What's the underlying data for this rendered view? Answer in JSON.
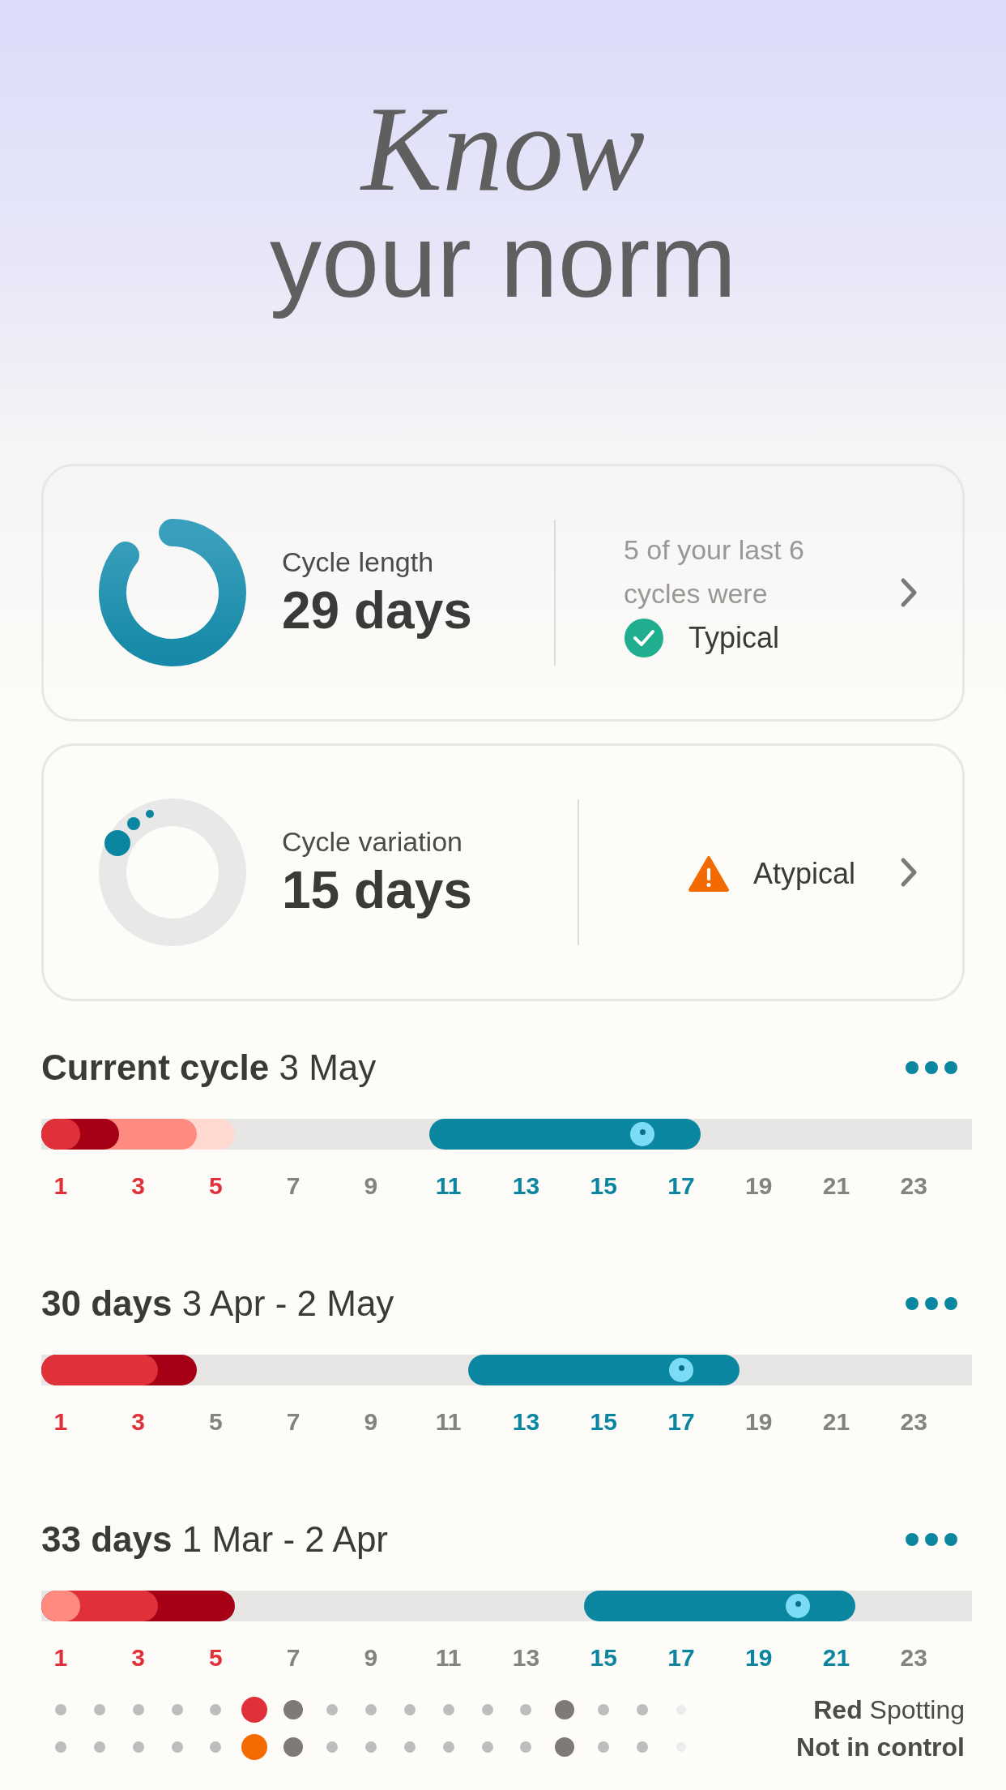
{
  "hero": {
    "line_1": "Know",
    "line_2": "your norm"
  },
  "cards": [
    {
      "kind": "length",
      "label": "Cycle length",
      "value": "29 days",
      "note": "5 of your last 6 cycles were",
      "status": {
        "kind": "typical",
        "label": "Typical"
      }
    },
    {
      "kind": "variation",
      "label": "Cycle variation",
      "value": "15 days",
      "status": {
        "kind": "atypical",
        "label": "Atypical"
      }
    }
  ],
  "cycles": [
    {
      "title_bold": "Current cycle",
      "title_rest": "3 May",
      "days": [
        {
          "kind": "medium"
        },
        {
          "kind": "heavy"
        },
        {
          "kind": "light"
        },
        {
          "kind": "light"
        },
        {
          "kind": "spotting"
        },
        {
          "kind": "none"
        },
        {
          "kind": "none"
        },
        {
          "kind": "none"
        },
        {
          "kind": "none"
        },
        {
          "kind": "none"
        },
        {
          "kind": "fertile"
        },
        {
          "kind": "fertile"
        },
        {
          "kind": "fertile"
        },
        {
          "kind": "fertile"
        },
        {
          "kind": "fertile"
        },
        {
          "kind": "ovulation"
        },
        {
          "kind": "fertile"
        },
        {
          "kind": "none"
        },
        {
          "kind": "none"
        },
        {
          "kind": "none"
        },
        {
          "kind": "none"
        },
        {
          "kind": "none"
        },
        {
          "kind": "none"
        },
        {
          "kind": "none"
        }
      ],
      "labels": [
        "1",
        "3",
        "5",
        "7",
        "9",
        "11",
        "13",
        "15",
        "17",
        "19",
        "21",
        "23"
      ]
    },
    {
      "title_bold": "30 days",
      "title_rest": "3 Apr - 2 May",
      "days": [
        {
          "kind": "medium"
        },
        {
          "kind": "medium"
        },
        {
          "kind": "medium"
        },
        {
          "kind": "heavy"
        },
        {
          "kind": "none"
        },
        {
          "kind": "none"
        },
        {
          "kind": "none"
        },
        {
          "kind": "none"
        },
        {
          "kind": "none"
        },
        {
          "kind": "none"
        },
        {
          "kind": "none"
        },
        {
          "kind": "fertile"
        },
        {
          "kind": "fertile"
        },
        {
          "kind": "fertile"
        },
        {
          "kind": "fertile"
        },
        {
          "kind": "fertile"
        },
        {
          "kind": "ovulation"
        },
        {
          "kind": "fertile"
        },
        {
          "kind": "none"
        },
        {
          "kind": "none"
        },
        {
          "kind": "none"
        },
        {
          "kind": "none"
        },
        {
          "kind": "none"
        },
        {
          "kind": "none"
        }
      ],
      "labels": [
        "1",
        "3",
        "5",
        "7",
        "9",
        "11",
        "13",
        "15",
        "17",
        "19",
        "21",
        "23"
      ]
    },
    {
      "title_bold": "33 days",
      "title_rest": "1 Mar - 2 Apr",
      "days": [
        {
          "kind": "light"
        },
        {
          "kind": "medium"
        },
        {
          "kind": "medium"
        },
        {
          "kind": "heavy"
        },
        {
          "kind": "heavy"
        },
        {
          "kind": "none"
        },
        {
          "kind": "none"
        },
        {
          "kind": "none"
        },
        {
          "kind": "none"
        },
        {
          "kind": "none"
        },
        {
          "kind": "none"
        },
        {
          "kind": "none"
        },
        {
          "kind": "none"
        },
        {
          "kind": "none"
        },
        {
          "kind": "fertile"
        },
        {
          "kind": "fertile"
        },
        {
          "kind": "fertile"
        },
        {
          "kind": "fertile"
        },
        {
          "kind": "fertile"
        },
        {
          "kind": "ovulation"
        },
        {
          "kind": "fertile"
        },
        {
          "kind": "none"
        },
        {
          "kind": "none"
        },
        {
          "kind": "none"
        }
      ],
      "labels": [
        "1",
        "3",
        "5",
        "7",
        "9",
        "11",
        "13",
        "15",
        "17",
        "19",
        "21",
        "23"
      ],
      "dot_rows": [
        {
          "label_bold": "Red",
          "label_rest": "Spotting",
          "dots": [
            {
              "kind": "small"
            },
            {
              "kind": "small"
            },
            {
              "kind": "small"
            },
            {
              "kind": "small"
            },
            {
              "kind": "small"
            },
            {
              "kind": "red"
            },
            {
              "kind": "dark"
            },
            {
              "kind": "small"
            },
            {
              "kind": "small"
            },
            {
              "kind": "small"
            },
            {
              "kind": "small"
            },
            {
              "kind": "small"
            },
            {
              "kind": "small"
            },
            {
              "kind": "dark"
            },
            {
              "kind": "small"
            },
            {
              "kind": "small"
            },
            {
              "kind": "faint"
            }
          ]
        },
        {
          "label_bold": "Not in control",
          "dots": [
            {
              "kind": "small"
            },
            {
              "kind": "small"
            },
            {
              "kind": "small"
            },
            {
              "kind": "small"
            },
            {
              "kind": "small"
            },
            {
              "kind": "orange"
            },
            {
              "kind": "dark"
            },
            {
              "kind": "small"
            },
            {
              "kind": "small"
            },
            {
              "kind": "small"
            },
            {
              "kind": "small"
            },
            {
              "kind": "small"
            },
            {
              "kind": "small"
            },
            {
              "kind": "dark"
            },
            {
              "kind": "small"
            },
            {
              "kind": "small"
            },
            {
              "kind": "faint"
            }
          ]
        }
      ]
    }
  ]
}
